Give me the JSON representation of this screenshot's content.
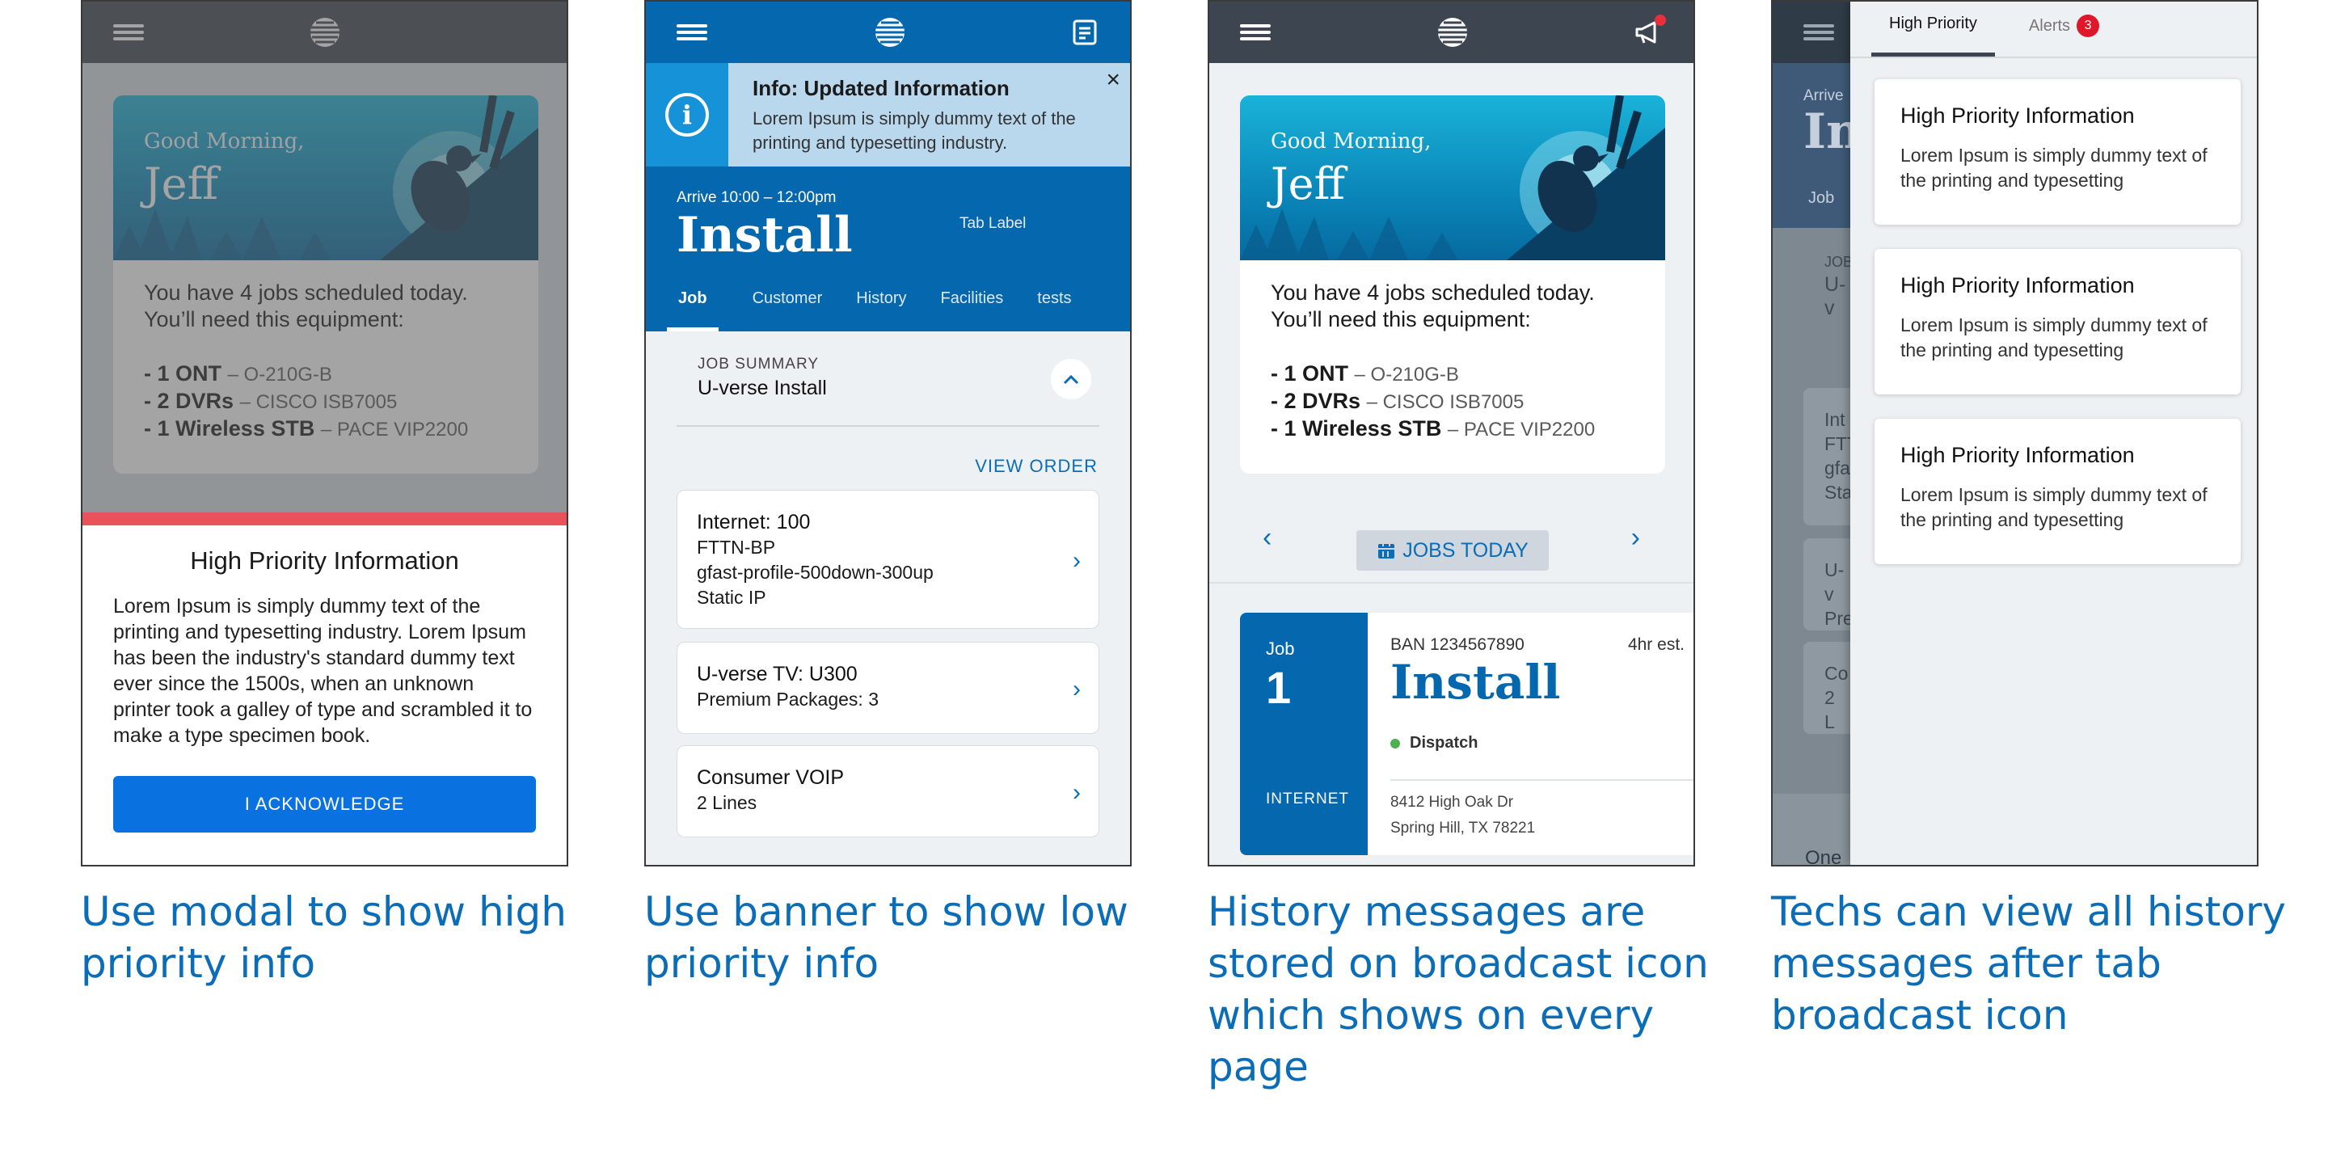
{
  "panel1": {
    "greeting": "Good Morning,",
    "name": "Jeff",
    "jobs_line1": "You have 4 jobs scheduled today.",
    "jobs_line2": "You’ll need this equipment:",
    "equipment": [
      {
        "qty": "- 1 ONT",
        "model": "– O-210G-B"
      },
      {
        "qty": "- 2 DVRs",
        "model": "– CISCO ISB7005"
      },
      {
        "qty": "- 1 Wireless STB",
        "model": "– PACE VIP2200"
      }
    ],
    "modal_title": "High Priority Information",
    "modal_body": "Lorem Ipsum is simply dummy text of the printing and typesetting industry. Lorem Ipsum has been the industry's standard dummy text ever since the 1500s, when an unknown printer took a galley of type and scrambled it to make a type specimen book.",
    "ack_label": "I ACKNOWLEDGE",
    "caption": "Use modal to show high\npriority info"
  },
  "panel2": {
    "banner_title": "Info: Updated Information",
    "banner_body": "Lorem Ipsum is simply dummy text of the printing and typesetting industry.",
    "arrive": "Arrive 10:00 – 12:00pm",
    "job_title": "Install",
    "tab_label": "Tab Label",
    "tabs": [
      "Job",
      "Customer",
      "History",
      "Facilities",
      "tests"
    ],
    "summary_label": "JOB SUMMARY",
    "summary_value": "U-verse Install",
    "view_order": "VIEW ORDER",
    "rows": [
      {
        "title": "Internet: 100",
        "lines": [
          "FTTN-BP",
          "gfast-profile-500down-300up",
          "Static IP"
        ]
      },
      {
        "title": "U-verse TV: U300",
        "lines": [
          "Premium Packages: 3"
        ]
      },
      {
        "title": "Consumer VOIP",
        "lines": [
          "2 Lines"
        ]
      }
    ],
    "caption": "Use banner to show low\npriority info"
  },
  "panel3": {
    "jobs_today": "JOBS TODAY",
    "job_word": "Job",
    "job_number": "1",
    "job_type": "INTERNET",
    "ban": "BAN 1234567890",
    "est": "4hr est.",
    "title": "Install",
    "status": "Dispatch",
    "addr1": "8412 High Oak Dr",
    "addr2": "Spring Hill, TX 78221",
    "caption": "History messages are\nstored on broadcast icon\nwhich shows on every\npage"
  },
  "panel4": {
    "tab_high": "High Priority",
    "tab_alerts": "Alerts",
    "alerts_count": "3",
    "cards": [
      {
        "title": "High Priority Information",
        "body": "Lorem Ipsum is simply dummy text of the printing and typesetting"
      },
      {
        "title": "High Priority Information",
        "body": "Lorem Ipsum is simply dummy text of the printing and typesetting"
      },
      {
        "title": "High Priority Information",
        "body": "Lorem Ipsum is simply dummy text of the printing and typesetting"
      }
    ],
    "bg_arrive": "Arrive",
    "bg_title": "In",
    "bg_tab": "Job",
    "bg_job": "JOB",
    "bg_uv": "U-v",
    "bg_int": "Int",
    "bg_int2": "FTT",
    "bg_int3": "gfa",
    "bg_int4": "Sta",
    "bg_u2": "U-v",
    "bg_u2b": "Pre",
    "bg_co": "Co",
    "bg_co2": "2 L",
    "bg_one": "One",
    "caption": "Techs can view all history\nmessages after tab\nbroadcast icon"
  },
  "colors": {
    "brand_blue": "#0568ae",
    "dark_bar": "#3c4a55",
    "accent_red": "#e9525a",
    "button_blue": "#0a72e0",
    "caption_blue": "#0b6db7"
  }
}
